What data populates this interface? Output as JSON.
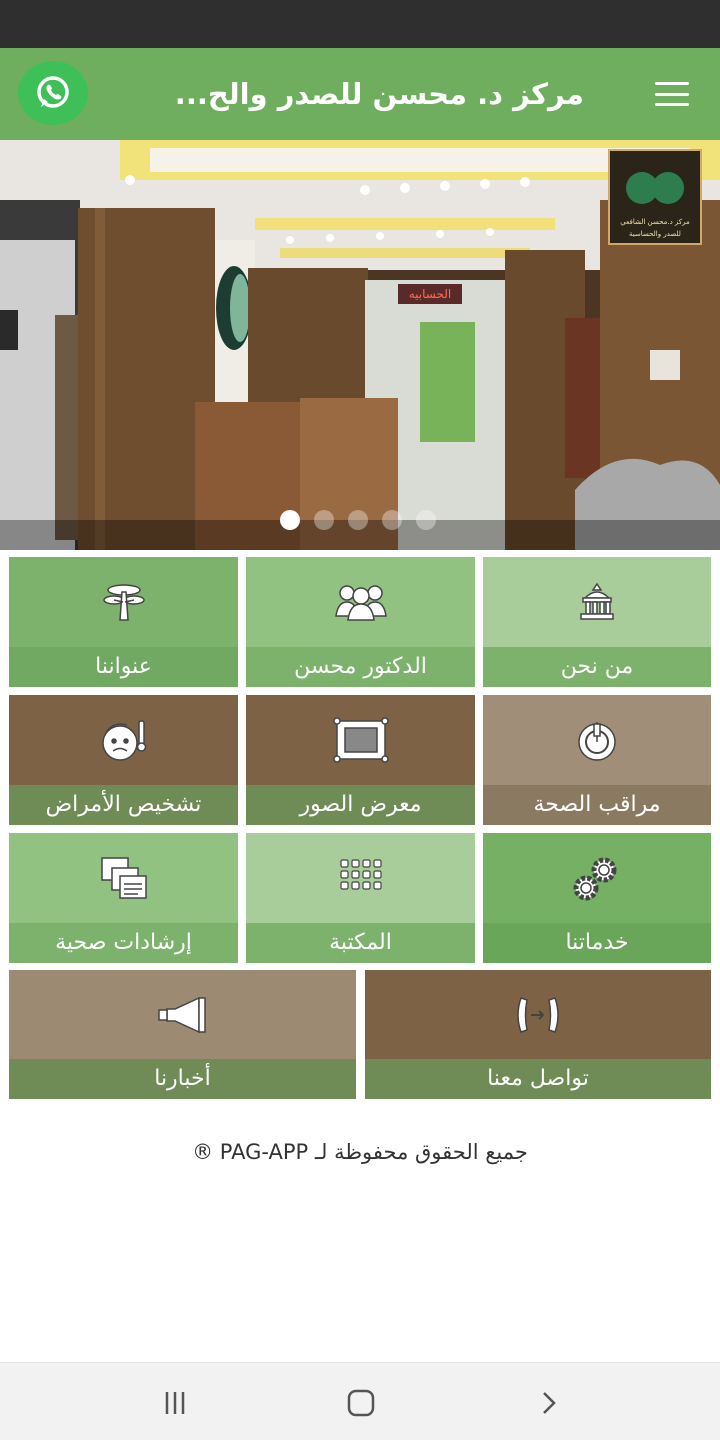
{
  "header": {
    "title": "مركز د. محسن للصدر والح...",
    "whatsapp_icon": "whatsapp-icon",
    "menu_icon": "hamburger-menu-icon"
  },
  "slider": {
    "logo_line1": "مركز د.محسن الشافعي",
    "logo_line2": "للصدر والحساسية",
    "sign_text": "الحسابيه",
    "dots_count": 5,
    "active_index": 0
  },
  "tiles": [
    {
      "label": "من نحن",
      "icon": "building-icon",
      "color_top": "#a9cc9b",
      "color_bottom": "#7db26d"
    },
    {
      "label": "الدكتور محسن",
      "icon": "people-group-icon",
      "color_top": "#91c282",
      "color_bottom": "#7db26d"
    },
    {
      "label": "عنواننا",
      "icon": "tree-icon",
      "color_top": "#7db26d",
      "color_bottom": "#71a862"
    },
    {
      "label": "مراقب الصحة",
      "icon": "health-monitor-icon",
      "color_top": "#a08e78",
      "color_bottom": "#8b7a62"
    },
    {
      "label": "معرض الصور",
      "icon": "picture-frame-icon",
      "color_top": "#7d6246",
      "color_bottom": "#6f8c56"
    },
    {
      "label": "تشخيص الأمراض",
      "icon": "sick-face-icon",
      "color_top": "#7d6246",
      "color_bottom": "#6f8c56"
    },
    {
      "label": "خدماتنا",
      "icon": "gears-icon",
      "color_top": "#76b064",
      "color_bottom": "#6aa65a"
    },
    {
      "label": "المكتبة",
      "icon": "grid-dots-icon",
      "color_top": "#a9cc9b",
      "color_bottom": "#7db26d"
    },
    {
      "label": "إرشادات صحية",
      "icon": "documents-icon",
      "color_top": "#91c282",
      "color_bottom": "#7db26d"
    },
    {
      "label": "تواصل معنا",
      "icon": "phone-icon",
      "color_top": "#7d6246",
      "color_bottom": "#6f8c56"
    },
    {
      "label": "أخبارنا",
      "icon": "megaphone-icon",
      "color_top": "#9c8a73",
      "color_bottom": "#6f8c56"
    }
  ],
  "footer": {
    "copyright": "جميع الحقوق محفوظة لـ PAG-APP ®"
  },
  "navbar": {
    "recent_icon": "recent-apps-icon",
    "home_icon": "home-icon",
    "back_icon": "back-icon"
  }
}
